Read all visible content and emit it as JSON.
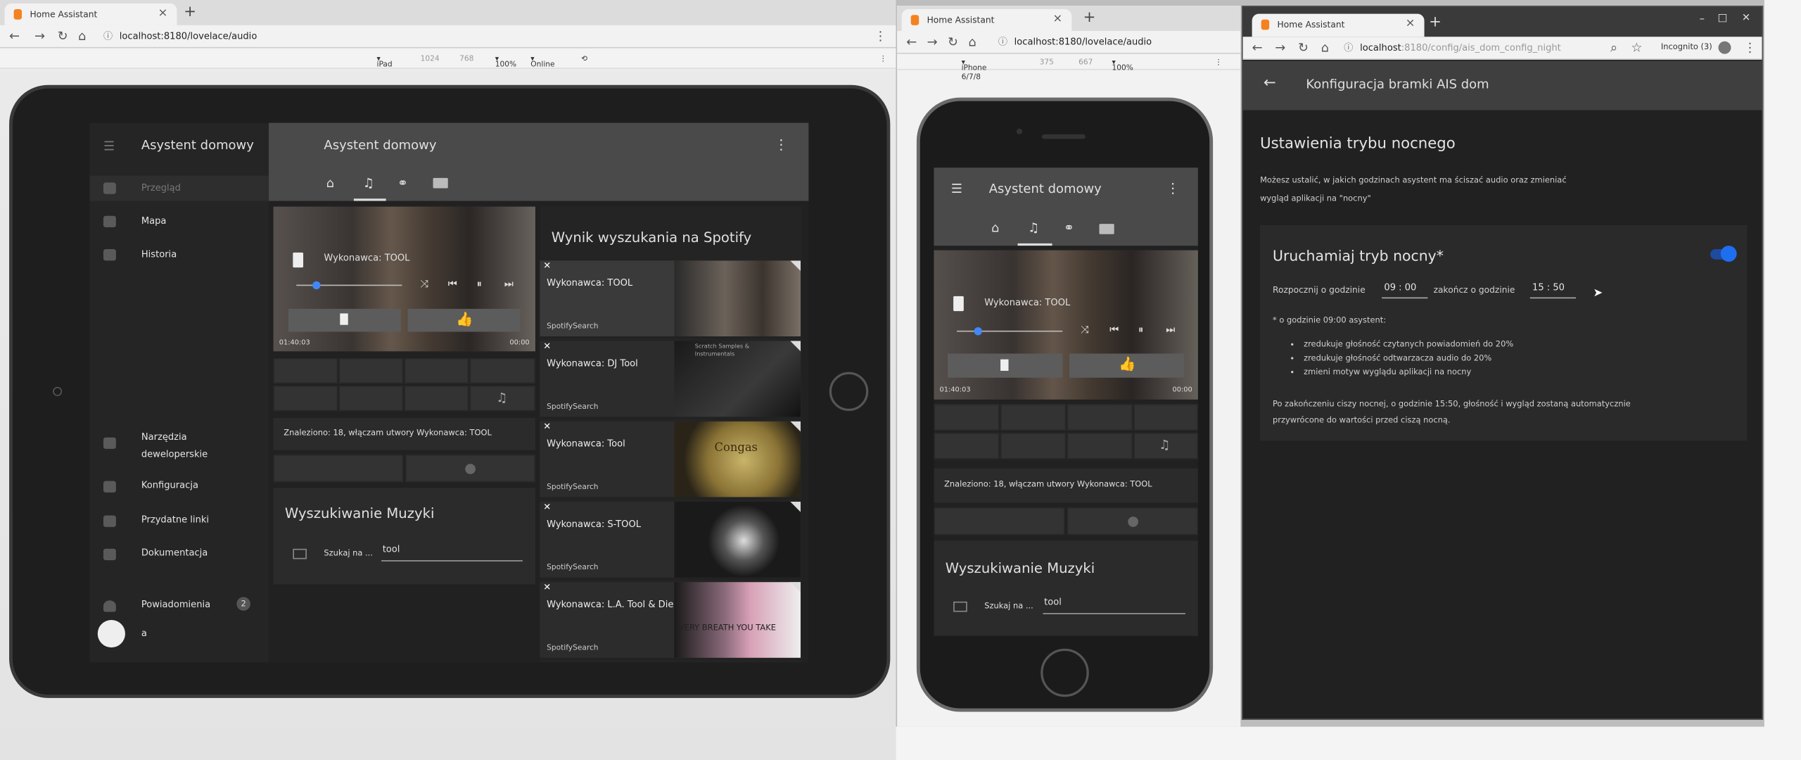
{
  "left_browser": {
    "tab_title": "Home Assistant",
    "url": "localhost:8180/lovelace/audio",
    "device": "iPad",
    "width": "1024",
    "height": "768",
    "zoom": "100%",
    "network": "Online"
  },
  "middle_browser": {
    "tab_title": "Home Assistant",
    "url": "localhost:8180/lovelace/audio",
    "device": "iPhone 6/7/8",
    "width": "375",
    "height": "667",
    "zoom": "100%"
  },
  "right_browser": {
    "tab_title": "Home Assistant",
    "url_host": "localhost",
    "url_path": ":8180/config/ais_dom_config_night",
    "incognito": "Incognito (3)",
    "window_min": "–",
    "window_max": "□",
    "window_close": "✕"
  },
  "ipad": {
    "sidebar_title": "Asystent domowy",
    "page_title": "Asystent domowy",
    "sidebar_items": [
      "Przegląd",
      "Mapa",
      "Historia"
    ],
    "sidebar_bottom": [
      "Narzędzia",
      "deweloperskie",
      "Konfiguracja",
      "Przydatne linki",
      "Dokumentacja"
    ],
    "notifications_label": "Powiadomienia",
    "notifications_count": "2",
    "user_initial": "a",
    "player_artist": "Wykonawca: TOOL",
    "time_elapsed": "01:40:03",
    "time_remaining": "00:00",
    "found_text": "Znaleziono: 18, włączam utwory Wykonawca: TOOL",
    "search_title": "Wyszukiwanie Muzyki",
    "search_label": "Szukaj na ...",
    "search_value": "tool",
    "results_title": "Wynik wyszukania na Spotify",
    "results": [
      {
        "title": "Wykonawca: TOOL",
        "source": "SpotifySearch"
      },
      {
        "title": "Wykonawca: DJ Tool",
        "source": "SpotifySearch",
        "thumb_text": "Scratch Samples & Instrumentals"
      },
      {
        "title": "Wykonawca: Tool",
        "source": "SpotifySearch",
        "thumb_text": "Congas"
      },
      {
        "title": "Wykonawca: S-TOOL",
        "source": "SpotifySearch"
      },
      {
        "title": "Wykonawca: L.A. Tool & Die",
        "source": "SpotifySearch",
        "thumb_text": "VERY BREATH YOU TAKE"
      }
    ]
  },
  "iphone": {
    "page_title": "Asystent domowy",
    "player_artist": "Wykonawca: TOOL",
    "time_elapsed": "01:40:03",
    "time_remaining": "00:00",
    "found_text": "Znaleziono: 18, włączam utwory Wykonawca: TOOL",
    "search_title": "Wyszukiwanie Muzyki",
    "search_label": "Szukaj na ...",
    "search_value": "tool"
  },
  "config": {
    "header_title": "Konfiguracja bramki AIS dom",
    "section_title": "Ustawienia trybu nocnego",
    "description_line1": "Możesz ustalić, w jakich godzinach asystent ma ściszać audio oraz zmieniać",
    "description_line2": "wygląd aplikacji na \"nocny\"",
    "card_title": "Uruchamiaj tryb nocny*",
    "start_label": "Rozpocznij o godzinie",
    "start_time": "09 : 00",
    "end_label": "zakończ o godzinie",
    "end_time": "15 : 50",
    "note": "* o godzinie 09:00 asystent:",
    "bullets": [
      "zredukuje głośność czytanych powiadomień do 20%",
      "zredukuje głośność odtwarzacza audio do 20%",
      "zmieni motyw wyglądu aplikacji na nocny"
    ],
    "footer_line1": "Po zakończeniu ciszy nocnej, o godzinie 15:50, głośność i wygląd zostaną automatycznie",
    "footer_line2": "przywrócone do wartości przed ciszą nocną.",
    "toggle_on": true,
    "accent": "#1e6ef0"
  }
}
